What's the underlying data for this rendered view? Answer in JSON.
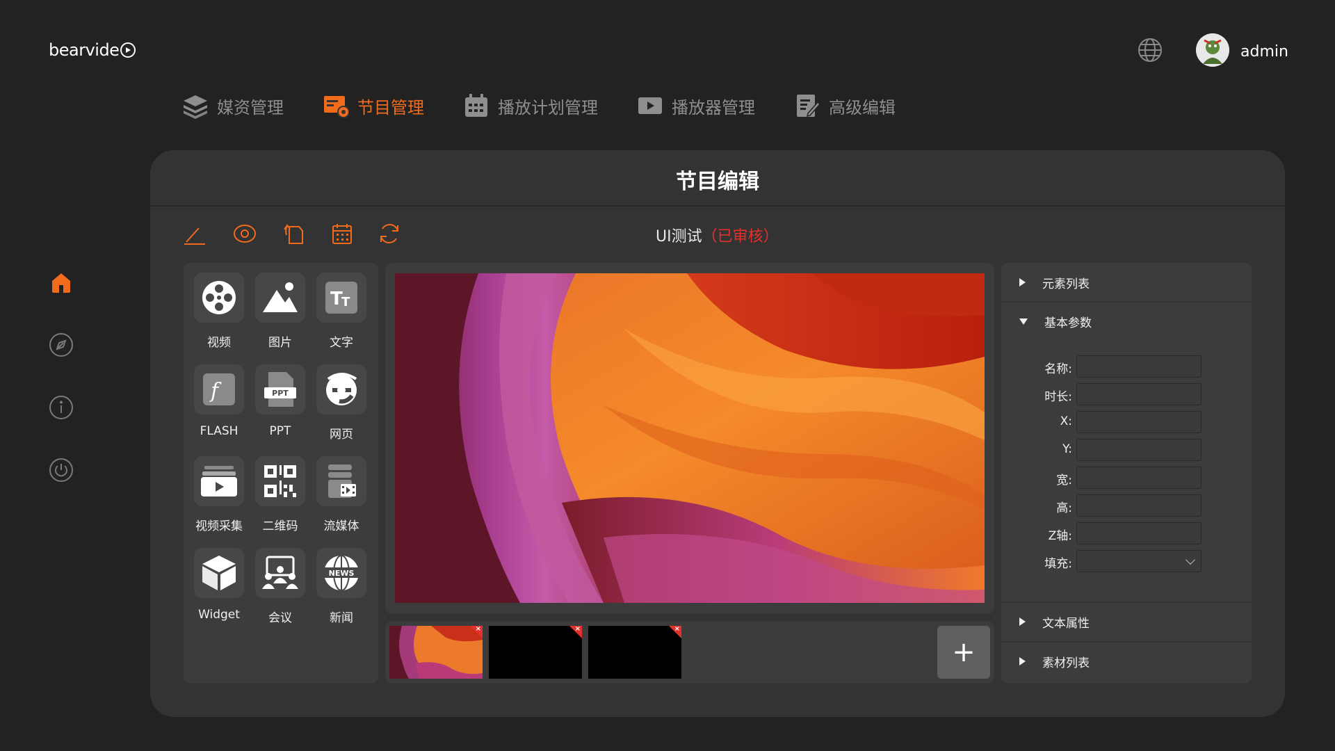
{
  "header": {
    "logo_text": "bearvide",
    "username": "admin"
  },
  "topnav": [
    {
      "label": "媒资管理",
      "icon": "layers-icon",
      "active": false
    },
    {
      "label": "节目管理",
      "icon": "program-icon",
      "active": true
    },
    {
      "label": "播放计划管理",
      "icon": "calendar-icon",
      "active": false
    },
    {
      "label": "播放器管理",
      "icon": "player-icon",
      "active": false
    },
    {
      "label": "高级编辑",
      "icon": "edit-doc-icon",
      "active": false
    }
  ],
  "sidebar": [
    "home-icon",
    "compass-icon",
    "info-icon",
    "power-icon"
  ],
  "panel": {
    "title": "节目编辑",
    "program_name": "UI测试",
    "program_status": "（已审核）"
  },
  "toolbar": [
    "pencil-icon",
    "eye-icon",
    "rotate-icon",
    "calendar-icon",
    "refresh-icon"
  ],
  "elements": [
    {
      "label": "视频",
      "icon": "film-reel-icon"
    },
    {
      "label": "图片",
      "icon": "image-icon"
    },
    {
      "label": "文字",
      "icon": "text-icon"
    },
    {
      "label": "FLASH",
      "icon": "flash-icon"
    },
    {
      "label": "PPT",
      "icon": "ppt-icon",
      "badge": "PPT"
    },
    {
      "label": "网页",
      "icon": "browser-icon"
    },
    {
      "label": "视频采集",
      "icon": "video-capture-icon"
    },
    {
      "label": "二维码",
      "icon": "qrcode-icon"
    },
    {
      "label": "流媒体",
      "icon": "streaming-icon"
    },
    {
      "label": "Widget",
      "icon": "cube-icon"
    },
    {
      "label": "会议",
      "icon": "meeting-icon"
    },
    {
      "label": "新闻",
      "icon": "news-icon",
      "badge": "NEWS"
    }
  ],
  "pages": [
    {
      "has_image": true
    },
    {
      "has_image": false
    },
    {
      "has_image": false
    }
  ],
  "add_page_label": "+",
  "props": {
    "sections": {
      "elements_list": "元素列表",
      "basic_params": "基本参数",
      "text_props": "文本属性",
      "material_list": "素材列表"
    },
    "fields": [
      {
        "label": "名称:",
        "value": ""
      },
      {
        "label": "时长:",
        "value": ""
      },
      {
        "label": "X:",
        "value": ""
      },
      {
        "label": "Y:",
        "value": ""
      },
      {
        "label": "宽:",
        "value": ""
      },
      {
        "label": "高:",
        "value": ""
      },
      {
        "label": "Z轴:",
        "value": ""
      },
      {
        "label": "填充:",
        "value": ""
      }
    ]
  },
  "colors": {
    "accent": "#f26b1d",
    "status_red": "#e3302a",
    "background": "#222222",
    "panel": "#333333"
  }
}
